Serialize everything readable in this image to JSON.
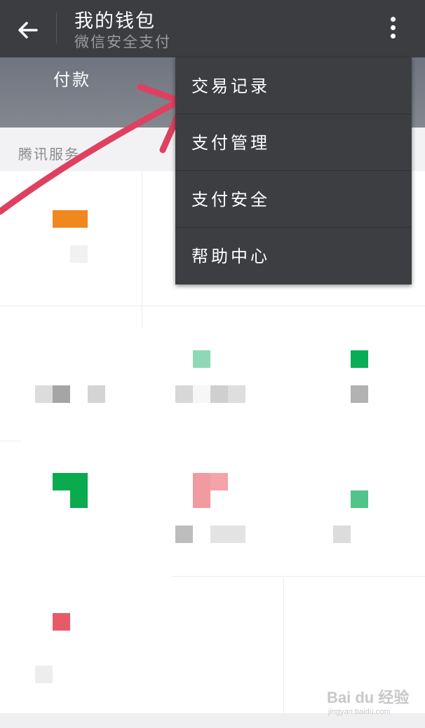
{
  "header": {
    "title": "我的钱包",
    "subtitle": "微信安全支付",
    "back_icon": "back-arrow-icon",
    "more_icon": "more-vertical-icon"
  },
  "banner": {
    "label": "付款"
  },
  "section": {
    "label": "腾讯服务"
  },
  "menu": {
    "items": [
      {
        "label": "交易记录"
      },
      {
        "label": "支付管理"
      },
      {
        "label": "支付安全"
      },
      {
        "label": "帮助中心"
      }
    ]
  },
  "watermark": {
    "brand": "Bai du 经验",
    "domain": "jingyan.baidu.com"
  },
  "colors": {
    "header_bg": "#3c3d41",
    "menu_bg": "#3d3e42",
    "annotation": "#e0405f"
  }
}
